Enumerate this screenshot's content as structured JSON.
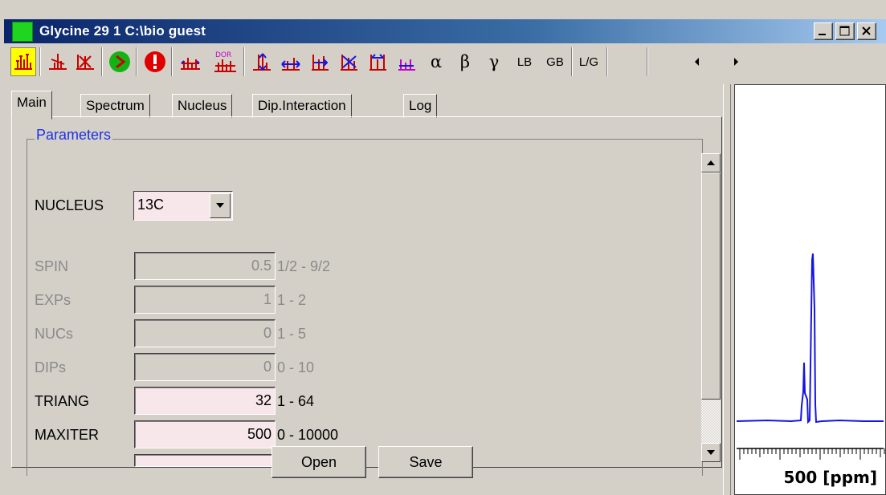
{
  "window": {
    "title": "Glycine 29  1  C:\\bio  guest"
  },
  "toolbar": {
    "icons": [
      "spectrum-view-icon",
      "peak-split-icon",
      "peak-remove-icon",
      "run-icon",
      "stop-icon",
      "fit-icon",
      "dor-fit-icon",
      "expand-vertical-icon",
      "expand-horizontal-icon",
      "zoom-in-icon",
      "zoom-out-icon",
      "shift-icon",
      "integrate-icon"
    ],
    "dor_text": "DOR",
    "alpha": "α",
    "beta": "β",
    "gamma": "γ",
    "lb": "LB",
    "gb": "GB",
    "lg": "L/G"
  },
  "tabs": [
    {
      "label": "Main",
      "selected": true
    },
    {
      "label": "Spectrum",
      "selected": false
    },
    {
      "label": "Nucleus",
      "selected": false
    },
    {
      "label": "Dip.Interaction",
      "selected": false
    },
    {
      "label": "Log",
      "selected": false
    }
  ],
  "parameters": {
    "title": "Parameters",
    "nucleus_label": "NUCLEUS",
    "nucleus_value": "13C",
    "rows": [
      {
        "label": "SPIN",
        "value": "0.5",
        "range": "1/2 - 9/2",
        "editable": false
      },
      {
        "label": "EXPs",
        "value": "1",
        "range": "1 - 2",
        "editable": false
      },
      {
        "label": "NUCs",
        "value": "0",
        "range": "1 - 5",
        "editable": false
      },
      {
        "label": "DIPs",
        "value": "0",
        "range": "0 - 10",
        "editable": false
      },
      {
        "label": "TRIANG",
        "value": "32",
        "range": "1 - 64",
        "editable": true
      },
      {
        "label": "MAXITER",
        "value": "500",
        "range": "0 - 10000",
        "editable": true
      }
    ]
  },
  "buttons": {
    "open": "Open",
    "save": "Save"
  },
  "spectrum": {
    "axis_label": "500 [ppm]",
    "line_color": "#1414e6"
  }
}
